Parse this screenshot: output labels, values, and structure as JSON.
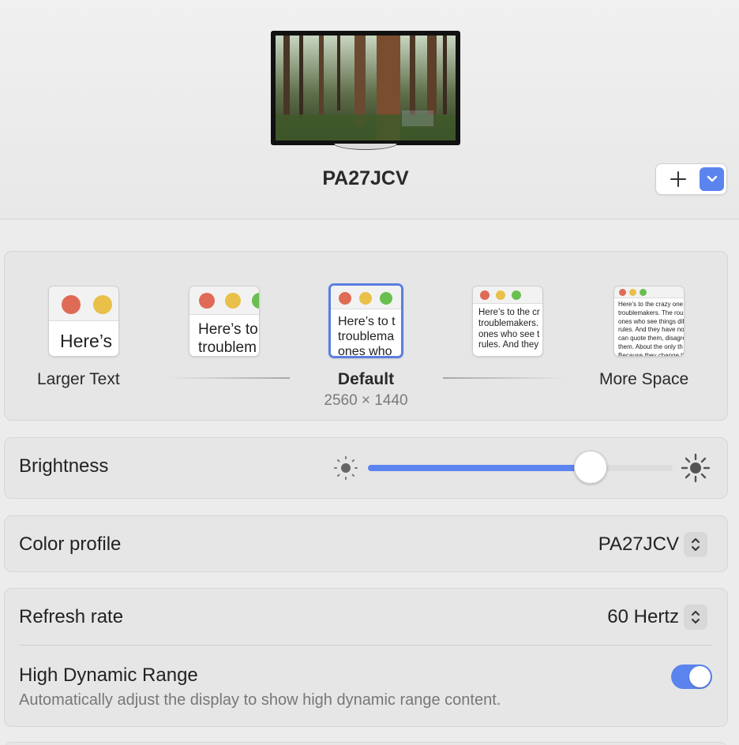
{
  "display": {
    "name": "PA27JCV"
  },
  "resolution": {
    "options": [
      {
        "label": "Larger Text",
        "preview": "Here’s"
      },
      {
        "label": "",
        "preview": "Here’s to\ntroublem"
      },
      {
        "label": "Default",
        "preview": "Here’s to t\ntroublema\nones who"
      },
      {
        "label": "",
        "preview": "Here’s to the cr\ntroublemakers.\nones who see t\nrules. And they"
      },
      {
        "label": "More Space",
        "preview": "Here’s to the crazy one\ntroublemakers. The roun\nones who see things diff\nrules. And they have no\ncan quote them, disagre\nthem. About the only th\nBecause they change th"
      }
    ],
    "selected_size": "2560 × 1440"
  },
  "brightness": {
    "label": "Brightness",
    "level": 0.73
  },
  "color_profile": {
    "label": "Color profile",
    "value": "PA27JCV"
  },
  "refresh_rate": {
    "label": "Refresh rate",
    "value": "60 Hertz"
  },
  "hdr": {
    "label": "High Dynamic Range",
    "description": "Automatically adjust the display to show high dynamic range content.",
    "enabled": true
  },
  "colors": {
    "accent": "#5b84ee",
    "red_dot": "#df6b57",
    "yellow_dot": "#e9c04a",
    "green_dot": "#69bf4f"
  }
}
